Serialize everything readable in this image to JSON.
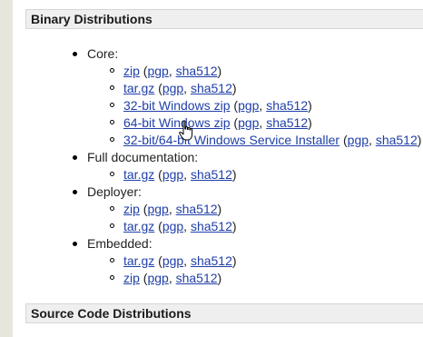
{
  "sections": {
    "binary_title": "Binary Distributions",
    "source_title": "Source Code Distributions"
  },
  "categories": {
    "core": "Core:",
    "fulldocs": "Full documentation:",
    "deployer": "Deployer:",
    "embedded": "Embedded:"
  },
  "core": [
    {
      "main": "zip",
      "pgp": "pgp",
      "sha": "sha512"
    },
    {
      "main": "tar.gz",
      "pgp": "pgp",
      "sha": "sha512"
    },
    {
      "main": "32-bit Windows zip",
      "pgp": "pgp",
      "sha": "sha512"
    },
    {
      "main": "64-bit Windows zip",
      "pgp": "pgp",
      "sha": "sha512"
    },
    {
      "main": "32-bit/64-bit Windows Service Installer",
      "pgp": "pgp",
      "sha": "sha512"
    }
  ],
  "fulldocs": [
    {
      "main": "tar.gz",
      "pgp": "pgp",
      "sha": "sha512"
    }
  ],
  "deployer": [
    {
      "main": "zip",
      "pgp": "pgp",
      "sha": "sha512"
    },
    {
      "main": "tar.gz",
      "pgp": "pgp",
      "sha": "sha512"
    }
  ],
  "embedded": [
    {
      "main": "tar.gz",
      "pgp": "pgp",
      "sha": "sha512"
    },
    {
      "main": "zip",
      "pgp": "pgp",
      "sha": "sha512"
    }
  ],
  "punct": {
    "open": " (",
    "sep": ", ",
    "close": ")"
  }
}
